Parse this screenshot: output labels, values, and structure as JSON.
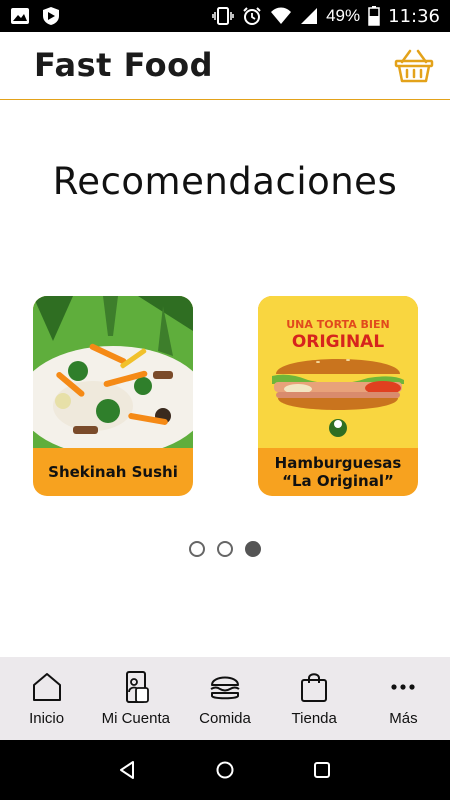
{
  "status_bar": {
    "battery": "49%",
    "time": "11:36"
  },
  "app": {
    "title": "Fast Food"
  },
  "section": {
    "title": "Recomendaciones"
  },
  "cards": [
    {
      "label": "Shekinah Sushi"
    },
    {
      "label": "Hamburguesas\n“La Original”",
      "image_top_text": "UNA TORTA BIEN",
      "image_main_text": "ORIGINAL"
    }
  ],
  "carousel": {
    "total": 3,
    "active_index": 2
  },
  "bottom_nav": [
    {
      "label": "Inicio",
      "icon": "home-icon"
    },
    {
      "label": "Mi Cuenta",
      "icon": "account-phone-icon"
    },
    {
      "label": "Comida",
      "icon": "burger-icon"
    },
    {
      "label": "Tienda",
      "icon": "shopping-bag-icon"
    },
    {
      "label": "Más",
      "icon": "more-dots-icon"
    }
  ],
  "colors": {
    "accent": "#f7a21f",
    "nav_bg": "#ece9ec",
    "divider": "#e3a21a"
  }
}
